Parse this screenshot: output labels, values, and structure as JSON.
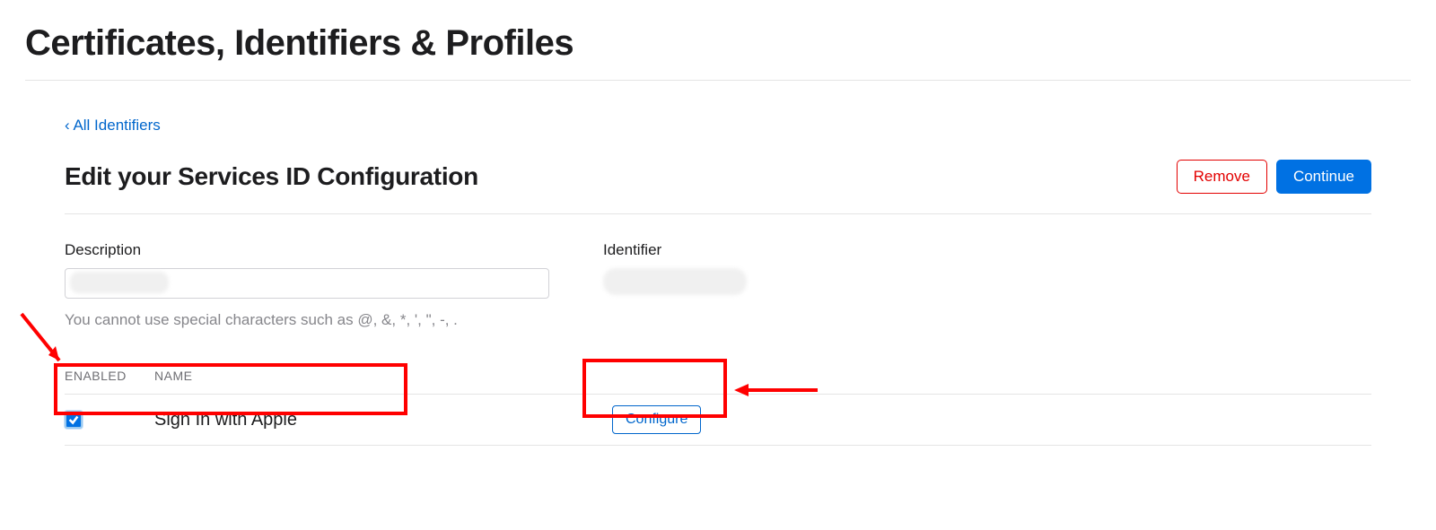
{
  "page": {
    "title": "Certificates, Identifiers & Profiles",
    "back_link": "‹ All Identifiers",
    "subtitle": "Edit your Services ID Configuration"
  },
  "actions": {
    "remove": "Remove",
    "continue": "Continue"
  },
  "form": {
    "description_label": "Description",
    "description_value": "",
    "description_hint": "You cannot use special characters such as @, &, *, ', \", -, .",
    "identifier_label": "Identifier",
    "identifier_value": ""
  },
  "capabilities": {
    "header_enabled": "ENABLED",
    "header_name": "NAME",
    "items": [
      {
        "enabled": true,
        "name": "Sign In with Apple",
        "action_label": "Configure"
      }
    ]
  }
}
